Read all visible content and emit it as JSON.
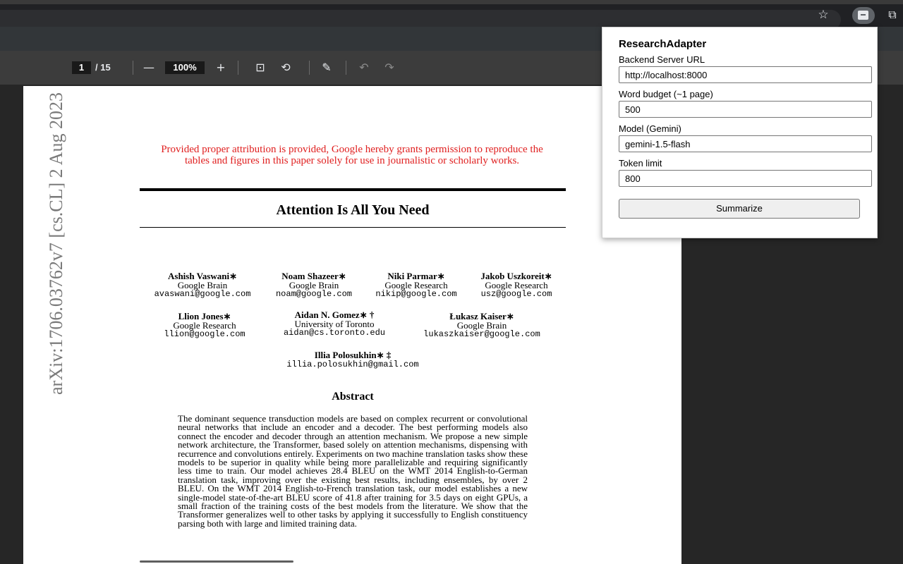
{
  "browser": {
    "star_icon": "☆",
    "extension_icon": "research-adapter-icon",
    "puzzle_icon": "⧉"
  },
  "pdf_toolbar": {
    "page_current": "1",
    "page_total": "/ 15",
    "zoom_out": "—",
    "zoom_value": "100%",
    "zoom_in": "+",
    "fit_icon": "⊡",
    "rotate_icon": "⟲",
    "annotate_icon": "✎",
    "undo_icon": "↶",
    "redo_icon": "↷"
  },
  "document": {
    "notice": "Provided proper attribution is provided, Google hereby grants permission to reproduce the tables and figures in this paper solely for use in journalistic or scholarly works.",
    "title": "Attention Is All You Need",
    "arxiv_id": "arXiv:1706.03762v7  [cs.CL]  2 Aug 2023",
    "authors": [
      {
        "name": "Ashish Vaswani∗",
        "affiliation": "Google Brain",
        "email": "avaswani@google.com"
      },
      {
        "name": "Noam Shazeer∗",
        "affiliation": "Google Brain",
        "email": "noam@google.com"
      },
      {
        "name": "Niki Parmar∗",
        "affiliation": "Google Research",
        "email": "nikip@google.com"
      },
      {
        "name": "Jakob Uszkoreit∗",
        "affiliation": "Google Research",
        "email": "usz@google.com"
      },
      {
        "name": "Llion Jones∗",
        "affiliation": "Google Research",
        "email": "llion@google.com"
      },
      {
        "name": "Aidan N. Gomez∗ †",
        "affiliation": "University of Toronto",
        "email": "aidan@cs.toronto.edu"
      },
      {
        "name": "Łukasz Kaiser∗",
        "affiliation": "Google Brain",
        "email": "lukaszkaiser@google.com"
      },
      {
        "name": "Illia Polosukhin∗ ‡",
        "affiliation": "",
        "email": "illia.polosukhin@gmail.com"
      }
    ],
    "abstract_heading": "Abstract",
    "abstract_text": "The dominant sequence transduction models are based on complex recurrent or convolutional neural networks that include an encoder and a decoder. The best performing models also connect the encoder and decoder through an attention mechanism. We propose a new simple network architecture, the Transformer, based solely on attention mechanisms, dispensing with recurrence and convolutions entirely. Experiments on two machine translation tasks show these models to be superior in quality while being more parallelizable and requiring significantly less time to train. Our model achieves 28.4 BLEU on the WMT 2014 English-to-German translation task, improving over the existing best results, including ensembles, by over 2 BLEU. On the WMT 2014 English-to-French translation task, our model establishes a new single-model state-of-the-art BLEU score of 41.8 after training for 3.5 days on eight GPUs, a small fraction of the training costs of the best models from the literature. We show that the Transformer generalizes well to other tasks by applying it successfully to English constituency parsing both with large and limited training data."
  },
  "popup": {
    "title": "ResearchAdapter",
    "backend_label": "Backend Server URL",
    "backend_value": "http://localhost:8000",
    "word_budget_label": "Word budget (~1 page)",
    "word_budget_value": "500",
    "model_label": "Model (Gemini)",
    "model_value": "gemini-1.5-flash",
    "token_label": "Token limit",
    "token_value": "800",
    "summarize_label": "Summarize"
  }
}
